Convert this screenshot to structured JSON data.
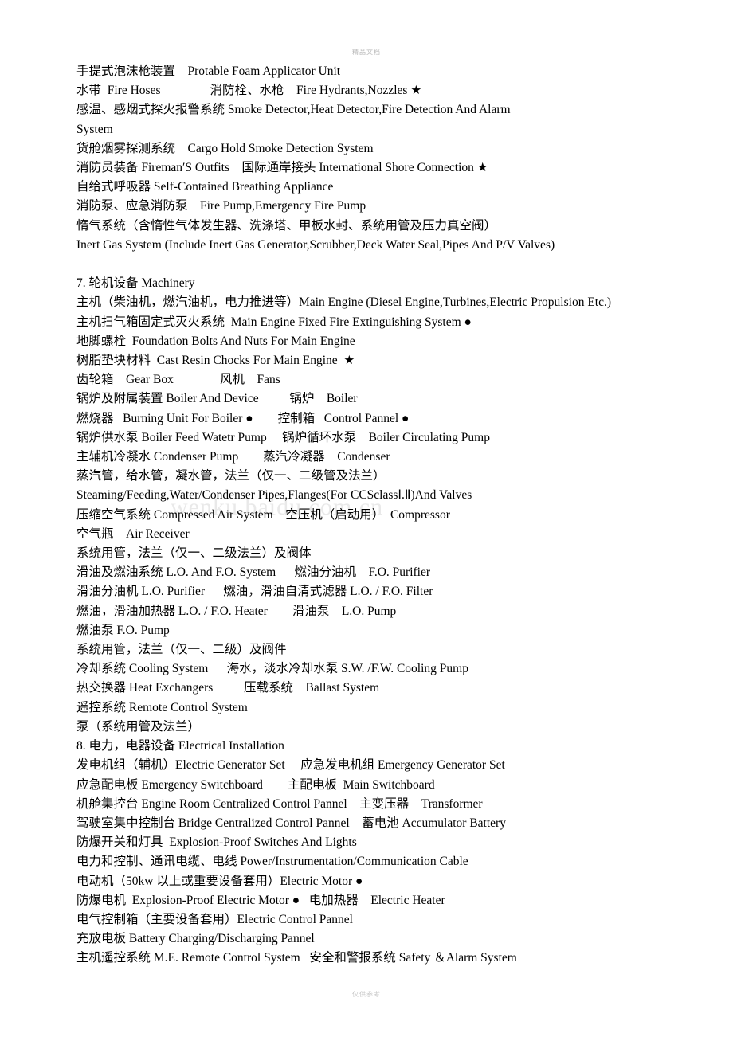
{
  "page": {
    "header_mark": "精品文档",
    "footer_mark": "仅供参考",
    "watermark": "wenku.baidu.com.cn"
  },
  "lines": [
    "手提式泡沫枪装置    Protable Foam Applicator Unit",
    "水带  Fire Hoses                消防栓、水枪    Fire Hydrants,Nozzles ★",
    "感温、感烟式探火报警系统 Smoke Detector,Heat Detector,Fire Detection And Alarm",
    "System",
    "货舱烟雾探测系统    Cargo Hold Smoke Detection System",
    "消防员装备 Fireman′S Outfits    国际通岸接头 International Shore Connection ★",
    "自给式呼吸器 Self-Contained Breathing Appliance",
    "消防泵、应急消防泵    Fire Pump,Emergency Fire Pump",
    "惰气系统（含惰性气体发生器、洗涤塔、甲板水封、系统用管及压力真空阀）",
    "Inert Gas System (Include Inert Gas Generator,Scrubber,Deck Water Seal,Pipes And P/V Valves)",
    "",
    "7. 轮机设备 Machinery",
    "主机（柴油机，燃汽油机，电力推进等）Main Engine (Diesel Engine,Turbines,Electric Propulsion Etc.)",
    "主机扫气箱固定式灭火系统  Main Engine Fixed Fire Extinguishing System ●",
    "地脚螺栓  Foundation Bolts And Nuts For Main Engine",
    "树脂垫块材料  Cast Resin Chocks For Main Engine  ★",
    "齿轮箱    Gear Box               风机    Fans",
    "锅炉及附属装置 Boiler And Device          锅炉    Boiler",
    "燃烧器   Burning Unit For Boiler ●        控制箱   Control Pannel ●",
    "锅炉供水泵 Boiler Feed Watetr Pump     锅炉循环水泵    Boiler Circulating Pump",
    "主辅机冷凝水 Condenser Pump        蒸汽冷凝器    Condenser",
    "蒸汽管，给水管，凝水管，法兰（仅一、二级管及法兰）",
    "Steaming/Feeding,Water/Condenser Pipes,Flanges(For CCSclassⅠ.Ⅱ)And Valves",
    "压缩空气系统 Compressed Air System    空压机（启动用）  Compressor",
    "空气瓶    Air Receiver",
    "系统用管，法兰（仅一、二级法兰）及阀体",
    "滑油及燃油系统 L.O. And F.O. System      燃油分油机    F.O. Purifier",
    "滑油分油机 L.O. Purifier      燃油，滑油自清式滤器 L.O. / F.O. Filter",
    "燃油，滑油加热器 L.O. / F.O. Heater        滑油泵    L.O. Pump",
    "燃油泵 F.O. Pump",
    "系统用管，法兰（仅一、二级）及阀件",
    "冷却系统 Cooling System      海水，淡水冷却水泵 S.W. /F.W. Cooling Pump",
    "热交换器 Heat Exchangers          压载系统    Ballast System",
    "遥控系统 Remote Control System",
    "泵（系统用管及法兰）",
    "8. 电力，电器设备 Electrical Installation",
    "发电机组（辅机）Electric Generator Set     应急发电机组 Emergency Generator Set",
    "应急配电板 Emergency Switchboard        主配电板  Main Switchboard",
    "机舱集控台 Engine Room Centralized Control Pannel    主变压器    Transformer",
    "驾驶室集中控制台 Bridge Centralized Control Pannel    蓄电池 Accumulator Battery",
    "防爆开关和灯具  Explosion-Proof Switches And Lights",
    "电力和控制、通讯电缆、电线 Power/Instrumentation/Communication Cable",
    "电动机（50kw 以上或重要设备套用）Electric Motor ●",
    "防爆电机  Explosion-Proof Electric Motor ●   电加热器    Electric Heater",
    "电气控制箱（主要设备套用）Electric Control Pannel",
    "充放电板 Battery Charging/Discharging Pannel",
    "主机遥控系统 M.E. Remote Control System   安全和警报系统 Safety ＆Alarm System"
  ]
}
